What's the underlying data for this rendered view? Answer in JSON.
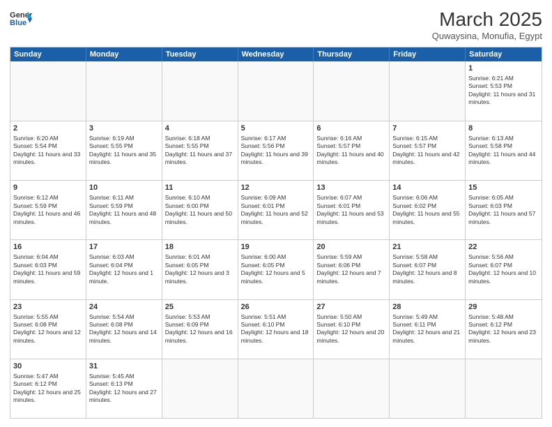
{
  "logo": {
    "general": "General",
    "blue": "Blue"
  },
  "header": {
    "month_year": "March 2025",
    "location": "Quwaysina, Monufia, Egypt"
  },
  "days_of_week": [
    "Sunday",
    "Monday",
    "Tuesday",
    "Wednesday",
    "Thursday",
    "Friday",
    "Saturday"
  ],
  "weeks": [
    [
      {
        "day": "",
        "empty": true
      },
      {
        "day": "",
        "empty": true
      },
      {
        "day": "",
        "empty": true
      },
      {
        "day": "",
        "empty": true
      },
      {
        "day": "",
        "empty": true
      },
      {
        "day": "",
        "empty": true
      },
      {
        "day": "1",
        "sunrise": "6:21 AM",
        "sunset": "5:53 PM",
        "daylight": "11 hours and 31 minutes."
      }
    ],
    [
      {
        "day": "2",
        "sunrise": "6:20 AM",
        "sunset": "5:54 PM",
        "daylight": "11 hours and 33 minutes."
      },
      {
        "day": "3",
        "sunrise": "6:19 AM",
        "sunset": "5:55 PM",
        "daylight": "11 hours and 35 minutes."
      },
      {
        "day": "4",
        "sunrise": "6:18 AM",
        "sunset": "5:55 PM",
        "daylight": "11 hours and 37 minutes."
      },
      {
        "day": "5",
        "sunrise": "6:17 AM",
        "sunset": "5:56 PM",
        "daylight": "11 hours and 39 minutes."
      },
      {
        "day": "6",
        "sunrise": "6:16 AM",
        "sunset": "5:57 PM",
        "daylight": "11 hours and 40 minutes."
      },
      {
        "day": "7",
        "sunrise": "6:15 AM",
        "sunset": "5:57 PM",
        "daylight": "11 hours and 42 minutes."
      },
      {
        "day": "8",
        "sunrise": "6:13 AM",
        "sunset": "5:58 PM",
        "daylight": "11 hours and 44 minutes."
      }
    ],
    [
      {
        "day": "9",
        "sunrise": "6:12 AM",
        "sunset": "5:59 PM",
        "daylight": "11 hours and 46 minutes."
      },
      {
        "day": "10",
        "sunrise": "6:11 AM",
        "sunset": "5:59 PM",
        "daylight": "11 hours and 48 minutes."
      },
      {
        "day": "11",
        "sunrise": "6:10 AM",
        "sunset": "6:00 PM",
        "daylight": "11 hours and 50 minutes."
      },
      {
        "day": "12",
        "sunrise": "6:09 AM",
        "sunset": "6:01 PM",
        "daylight": "11 hours and 52 minutes."
      },
      {
        "day": "13",
        "sunrise": "6:07 AM",
        "sunset": "6:01 PM",
        "daylight": "11 hours and 53 minutes."
      },
      {
        "day": "14",
        "sunrise": "6:06 AM",
        "sunset": "6:02 PM",
        "daylight": "11 hours and 55 minutes."
      },
      {
        "day": "15",
        "sunrise": "6:05 AM",
        "sunset": "6:03 PM",
        "daylight": "11 hours and 57 minutes."
      }
    ],
    [
      {
        "day": "16",
        "sunrise": "6:04 AM",
        "sunset": "6:03 PM",
        "daylight": "11 hours and 59 minutes."
      },
      {
        "day": "17",
        "sunrise": "6:03 AM",
        "sunset": "6:04 PM",
        "daylight": "12 hours and 1 minute."
      },
      {
        "day": "18",
        "sunrise": "6:01 AM",
        "sunset": "6:05 PM",
        "daylight": "12 hours and 3 minutes."
      },
      {
        "day": "19",
        "sunrise": "6:00 AM",
        "sunset": "6:05 PM",
        "daylight": "12 hours and 5 minutes."
      },
      {
        "day": "20",
        "sunrise": "5:59 AM",
        "sunset": "6:06 PM",
        "daylight": "12 hours and 7 minutes."
      },
      {
        "day": "21",
        "sunrise": "5:58 AM",
        "sunset": "6:07 PM",
        "daylight": "12 hours and 8 minutes."
      },
      {
        "day": "22",
        "sunrise": "5:56 AM",
        "sunset": "6:07 PM",
        "daylight": "12 hours and 10 minutes."
      }
    ],
    [
      {
        "day": "23",
        "sunrise": "5:55 AM",
        "sunset": "6:08 PM",
        "daylight": "12 hours and 12 minutes."
      },
      {
        "day": "24",
        "sunrise": "5:54 AM",
        "sunset": "6:08 PM",
        "daylight": "12 hours and 14 minutes."
      },
      {
        "day": "25",
        "sunrise": "5:53 AM",
        "sunset": "6:09 PM",
        "daylight": "12 hours and 16 minutes."
      },
      {
        "day": "26",
        "sunrise": "5:51 AM",
        "sunset": "6:10 PM",
        "daylight": "12 hours and 18 minutes."
      },
      {
        "day": "27",
        "sunrise": "5:50 AM",
        "sunset": "6:10 PM",
        "daylight": "12 hours and 20 minutes."
      },
      {
        "day": "28",
        "sunrise": "5:49 AM",
        "sunset": "6:11 PM",
        "daylight": "12 hours and 21 minutes."
      },
      {
        "day": "29",
        "sunrise": "5:48 AM",
        "sunset": "6:12 PM",
        "daylight": "12 hours and 23 minutes."
      }
    ],
    [
      {
        "day": "30",
        "sunrise": "5:47 AM",
        "sunset": "6:12 PM",
        "daylight": "12 hours and 25 minutes."
      },
      {
        "day": "31",
        "sunrise": "5:45 AM",
        "sunset": "6:13 PM",
        "daylight": "12 hours and 27 minutes."
      },
      {
        "day": "",
        "empty": true
      },
      {
        "day": "",
        "empty": true
      },
      {
        "day": "",
        "empty": true
      },
      {
        "day": "",
        "empty": true
      },
      {
        "day": "",
        "empty": true
      }
    ]
  ]
}
